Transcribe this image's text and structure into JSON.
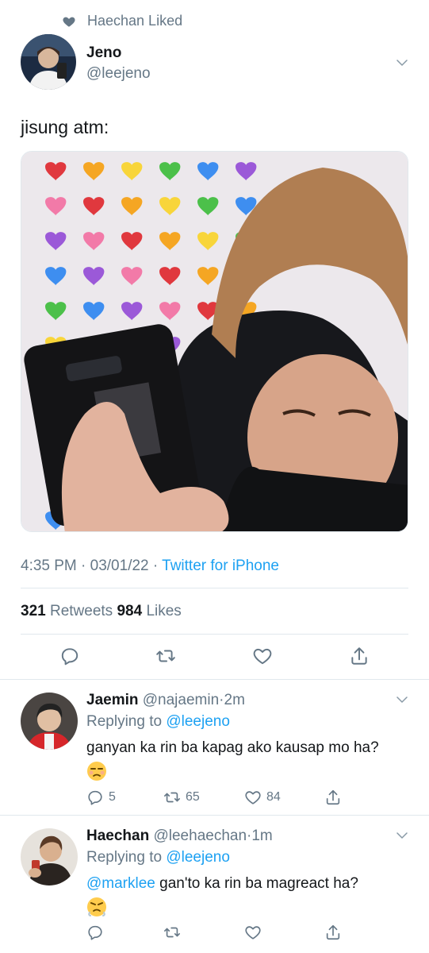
{
  "social_context": {
    "icon": "heart-icon",
    "text": "Haechan Liked"
  },
  "tweet": {
    "author_name": "Jeno",
    "author_handle": "@leejeno",
    "text": "jisung atm:",
    "time": "4:35 PM · 03/01/22 · ",
    "source": "Twitter for iPhone",
    "retweets_count": "321",
    "retweets_label": "Retweets",
    "likes_count": "984",
    "likes_label": "Likes"
  },
  "actions": {
    "reply_icon": "reply-icon",
    "retweet_icon": "retweet-icon",
    "like_icon": "like-icon",
    "share_icon": "share-icon"
  },
  "replies": [
    {
      "name": "Jaemin",
      "handle": "@najaemin",
      "dot": "·",
      "time": "2m",
      "replying_label": "Replying to",
      "replying_to": "@leejeno",
      "mention": "",
      "text": "ganyan ka rin ba kapag ako kausap mo ha?",
      "emoji": "unamused-face",
      "reply_count": "5",
      "retweet_count": "65",
      "like_count": "84"
    },
    {
      "name": "Haechan",
      "handle": "@leehaechan",
      "dot": "·",
      "time": "1m",
      "replying_label": "Replying to",
      "replying_to": "@leejeno",
      "mention": "@marklee",
      "text": " gan'to ka rin ba magreact ha?",
      "emoji": "huffing-face",
      "reply_count": "",
      "retweet_count": "",
      "like_count": ""
    }
  ],
  "colors": {
    "accent": "#1da1f2",
    "muted": "#657786",
    "text": "#14171a",
    "divider": "#e1e8ed"
  }
}
